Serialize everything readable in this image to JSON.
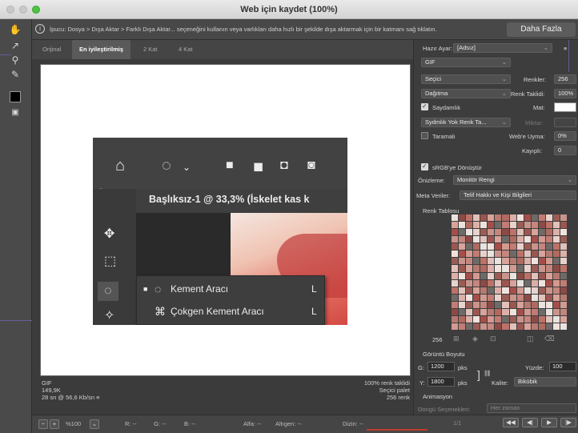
{
  "window": {
    "title": "Web için kaydet (100%)"
  },
  "hint": {
    "text": "İpucu: Dosya > Dışa Aktar > Farklı Dışa Aktar... seçeneğini kullanın veya varlıkları daha hızlı bir şekilde dışa aktarmak için bir katmanı sağ tıklatın.",
    "more_label": "Daha Fazla"
  },
  "tabs": [
    "Orijinal",
    "En iyileştirilmiş",
    "2 Kat",
    "4 Kat"
  ],
  "preview": {
    "doc_title": "Başlıksız-1 @ 33,3% (İskelet kas k",
    "panel_toggle": "»",
    "menu": [
      {
        "label": "Kement Aracı",
        "key": "L"
      },
      {
        "label": "Çokgen Kement Aracı",
        "key": "L"
      }
    ]
  },
  "status_left": [
    "GIF",
    "149,9K",
    "28 sn @ 56,6 Kb/sn"
  ],
  "status_left_icon": "≡",
  "status_right": [
    "100% renk taklidi",
    "Seçici palet",
    "256 renk"
  ],
  "bottom": {
    "zoom": "%100",
    "r": "R: --",
    "g": "G: --",
    "b": "B: --",
    "alfa": "Alfa: --",
    "altigen": "Altıgen: --",
    "dizin": "Dizin: --"
  },
  "settings": {
    "preset_label": "Hazır Ayar:",
    "preset_value": "[Adsız]",
    "format": "GIF",
    "reduction": "Seçici",
    "colors_label": "Renkler:",
    "colors_value": "256",
    "dither": "Dağıtma",
    "dither_label": "Renk Taklidi:",
    "dither_value": "100%",
    "transparency": "Saydamlık",
    "matte_label": "Mat:",
    "trans_dither": "Sydmlık Yok Renk Ta...",
    "amount_label": "Miktar:",
    "interlaced": "Taramalı",
    "websnap_label": "Web'e Uyma:",
    "websnap_value": "0%",
    "lossy_label": "Kayıplı:",
    "lossy_value": "0",
    "srgb": "sRGB'ye Dönüştür",
    "preview_label": "Önizleme:",
    "preview_value": "Monitör Rengi",
    "metadata_label": "Meta Veriler:",
    "metadata_value": "Telif Hakkı ve Kişi Bilgileri",
    "color_table": "Renk Tablosu",
    "color_count": "256",
    "image_size": "Görüntü Boyutu",
    "w_label": "G:",
    "w_value": "1200",
    "h_label": "Y:",
    "h_value": "1800",
    "unit": "pks",
    "percent_label": "Yüzde:",
    "percent_value": "100",
    "quality_label": "Kalite:",
    "quality_value": "Bikübik",
    "animation": "Animasyon",
    "loop_label": "Döngü Seçenekleri:",
    "loop_value": "Her zaman",
    "frame": "1/1"
  },
  "palette": [
    "#c4867d",
    "#b06a5f",
    "#9a5c55",
    "#d7a39a",
    "#c27c73",
    "#e1c1bb",
    "#a64e49",
    "#8c4a46",
    "#dcb0a8",
    "#c9948b",
    "#b67a70",
    "#e8d2cc",
    "#9b5650",
    "#d39a91",
    "#bd7268",
    "#f0e2dd"
  ]
}
